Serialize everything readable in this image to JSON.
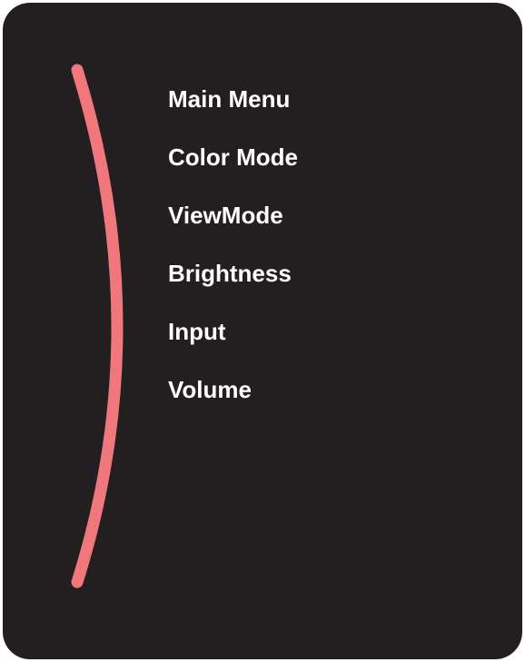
{
  "osd": {
    "arc_color": "#f0777c",
    "background_color": "#231f20",
    "menu_items": [
      {
        "label": "Main Menu"
      },
      {
        "label": "Color Mode"
      },
      {
        "label": "ViewMode"
      },
      {
        "label": "Brightness"
      },
      {
        "label": "Input"
      },
      {
        "label": "Volume"
      }
    ]
  }
}
